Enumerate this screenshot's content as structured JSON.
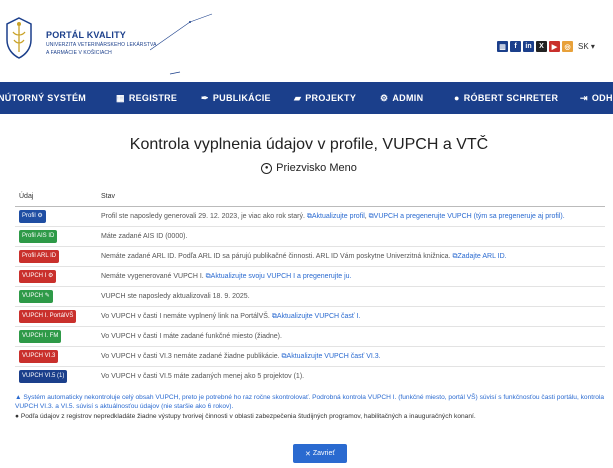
{
  "header": {
    "brand_title": "PORTÁL KVALITY",
    "brand_subtitle_1": "UNIVERZITA VETERINÁRSKEHO LEKÁRSTVA",
    "brand_subtitle_2": "A FARMÁCIE V KOŠICIACH",
    "social_icons": [
      "stats-icon",
      "facebook-icon",
      "linkedin-icon",
      "x-icon",
      "youtube-icon",
      "instagram-icon"
    ],
    "language": "SK",
    "colors": {
      "primary": "#1b3f8b",
      "link": "#2a6ad0"
    }
  },
  "nav": {
    "items": [
      {
        "label": "NÚTORNÝ SYSTÉM",
        "icon": ""
      },
      {
        "label": "REGISTRE",
        "icon": "table-icon"
      },
      {
        "label": "PUBLIKÁCIE",
        "icon": "pen-icon"
      },
      {
        "label": "PROJEKTY",
        "icon": "folder-icon"
      },
      {
        "label": "ADMIN",
        "icon": "gears-icon"
      },
      {
        "label": "RÓBERT SCHRETER",
        "icon": "user-icon"
      },
      {
        "label": "ODHL",
        "icon": "sign-out-icon"
      }
    ]
  },
  "modal": {
    "title": "Kontrola vyplnenia údajov v profile, VUPCH a VTČ",
    "subtitle": "Priezvisko Meno",
    "table_headers": {
      "col1": "Údaj",
      "col2": "Stav"
    },
    "rows": [
      {
        "badge": "Profil",
        "badge_color": "blue",
        "badge_icon": "⚙",
        "text": "Profil ste naposledy generovali 29. 12. 2023, je viac ako rok starý. ",
        "links": [
          "Aktualizujte profil",
          "VUPCH a pregenerujte VUPCH (tým sa pregeneruje aj profil)."
        ]
      },
      {
        "badge": "Profil AIS ID",
        "badge_color": "green",
        "text": "Máte zadané AIS ID (0000).",
        "links": []
      },
      {
        "badge": "Profil ARL ID",
        "badge_color": "red",
        "text": "Nemáte zadané ARL ID. Podľa ARL ID sa párujú publikačné činnosti. ARL ID Vám poskytne Univerzitná knižnica. ",
        "links": [
          "Zadajte ARL ID."
        ]
      },
      {
        "badge": "VUPCH I",
        "badge_color": "red",
        "badge_icon": "⚙",
        "text": "Nemáte vygenerované VUPCH I. ",
        "links": [
          "Aktualizujte svoju VUPCH I a pregenerujte ju."
        ]
      },
      {
        "badge": "VUPCH",
        "badge_color": "green",
        "badge_icon": "✎",
        "text": "VUPCH ste naposledy aktualizovali 18. 9. 2025.",
        "links": []
      },
      {
        "badge": "VUPCH I. PortálVŠ",
        "badge_color": "red",
        "text": "Vo VUPCH v časti I nemáte vyplnený link na PortálVŠ. ",
        "links": [
          "Aktualizujte VUPCH časť I."
        ]
      },
      {
        "badge": "VUPCH I. FM",
        "badge_color": "green",
        "text": "Vo VUPCH v časti I máte zadané funkčné miesto (žiadne).",
        "links": []
      },
      {
        "badge": "VUPCH VI.3",
        "badge_color": "red",
        "text": "Vo VUPCH v časti VI.3 nemáte zadané žiadne publikácie. ",
        "links": [
          "Aktualizujte VUPCH časť VI.3."
        ]
      },
      {
        "badge": "VUPCH VI.5 (1)",
        "badge_color": "navy",
        "text": "Vo VUPCH v časti VI.5 máte zadaných menej ako 5 projektov (1).",
        "links": []
      }
    ],
    "note_warning": "Systém automaticky nekontroluje celý obsah VUPCH, preto je potrebné ho raz ročne skontrolovať. Podrobná kontrola VUPCH I. (funkčné miesto, portál VŠ) súvisí s funkčnosťou časti portálu, kontrola VUPCH VI.3. a VI.5. súvisí s aktuálnosťou údajov (nie staršie ako 6 rokov).",
    "note_info": "Podľa údajov z registrov nepredkladáte žiadne výstupy tvorivej činnosti v oblasti zabezpečenia študijných programov, habilitačných a inauguračných konaní.",
    "close_label": "Zavrieť"
  }
}
